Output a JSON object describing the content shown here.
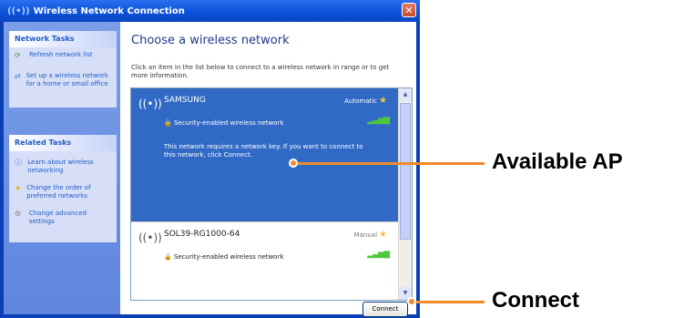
{
  "window": {
    "title": "Wireless Network Connection",
    "close_glyph": "✕"
  },
  "left_pane": {
    "network_tasks": {
      "header": "Network Tasks",
      "items": [
        {
          "label": "Refresh network list",
          "icon": "refresh-icon"
        },
        {
          "label": "Set up a wireless network for a home or small office",
          "icon": "setup-network-icon"
        }
      ]
    },
    "related_tasks": {
      "header": "Related Tasks",
      "items": [
        {
          "label": "Learn about wireless networking",
          "icon": "help-icon"
        },
        {
          "label": "Change the order of preferred networks",
          "icon": "star-icon"
        },
        {
          "label": "Change advanced settings",
          "icon": "settings-icon"
        }
      ]
    }
  },
  "content": {
    "heading": "Choose a wireless network",
    "instructions": "Click an item in the list below to connect to a wireless network in range or to get more information.",
    "networks": [
      {
        "name": "SAMSUNG",
        "mode": "Automatic",
        "security": "Security-enabled wireless network",
        "message": "This network requires a network key. If you want to connect to this network, click Connect.",
        "selected": true
      },
      {
        "name": "SOL39-RG1000-64",
        "mode": "Manual",
        "security": "Security-enabled wireless network",
        "selected": false
      }
    ],
    "connect_button": "Connect"
  },
  "annotations": {
    "available_ap": "Available AP",
    "connect": "Connect"
  },
  "colors": {
    "selected_row": "#316ac5",
    "annotation": "#f08a2a"
  }
}
